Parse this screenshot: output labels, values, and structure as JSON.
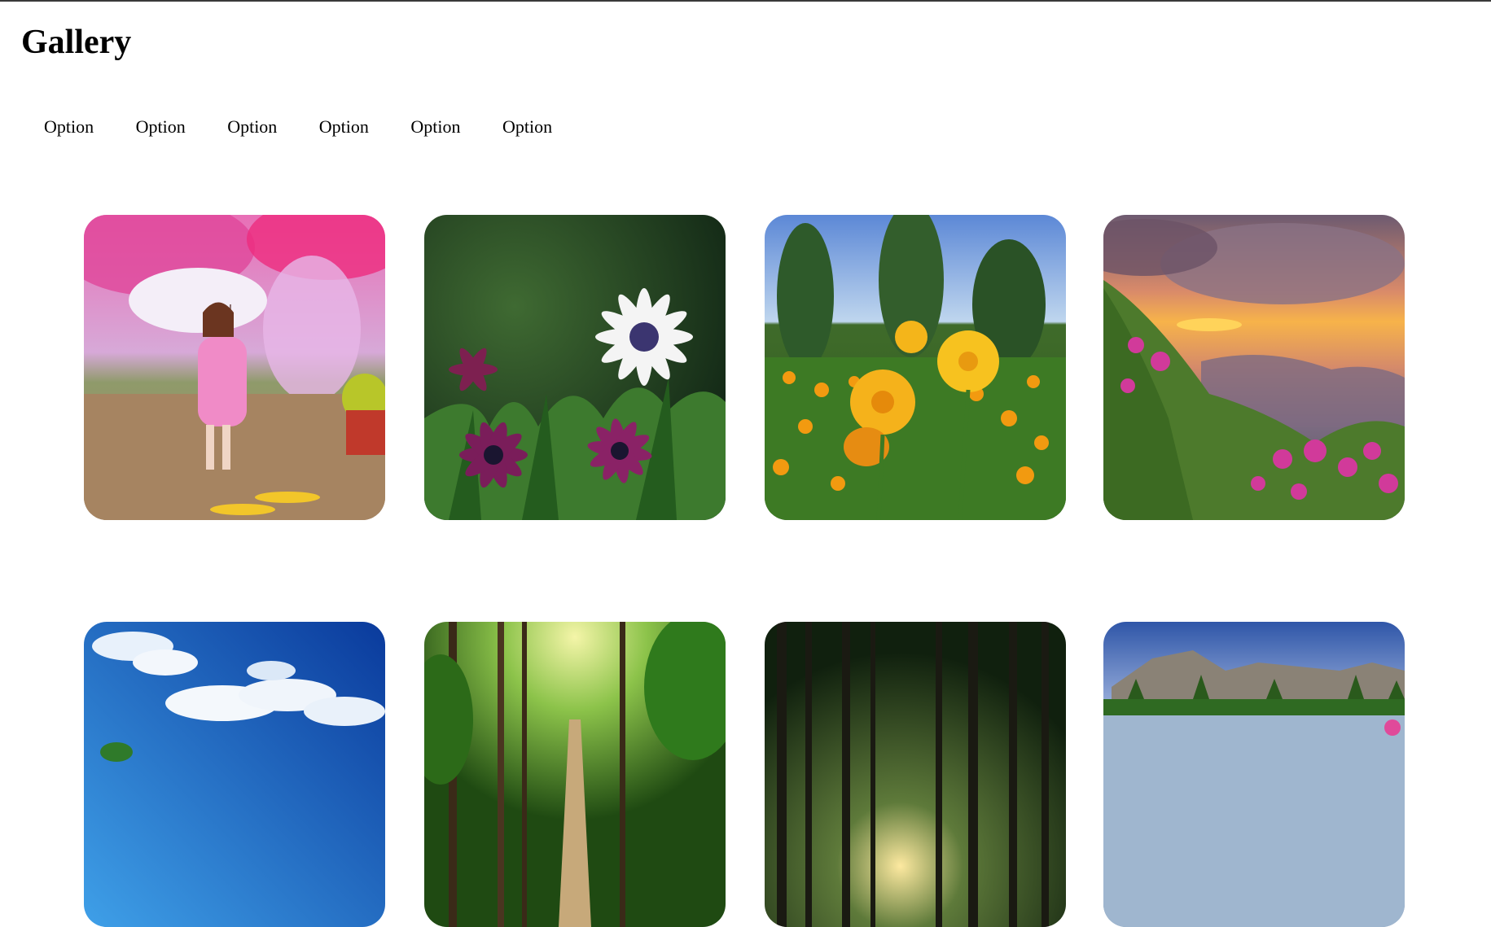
{
  "page": {
    "title": "Gallery"
  },
  "nav": {
    "items": [
      {
        "label": "Option"
      },
      {
        "label": "Option"
      },
      {
        "label": "Option"
      },
      {
        "label": "Option"
      },
      {
        "label": "Option"
      },
      {
        "label": "Option"
      }
    ]
  },
  "gallery": {
    "images": [
      {
        "subject": "woman-with-umbrella-under-blossoms"
      },
      {
        "subject": "white-and-purple-daisies"
      },
      {
        "subject": "yellow-marigold-field"
      },
      {
        "subject": "sunset-over-mountains-with-flowers"
      },
      {
        "subject": "blue-sky-with-clouds"
      },
      {
        "subject": "forest-path-green"
      },
      {
        "subject": "forest-sunlight-through-trees"
      },
      {
        "subject": "mountain-lake-reflection"
      }
    ]
  }
}
